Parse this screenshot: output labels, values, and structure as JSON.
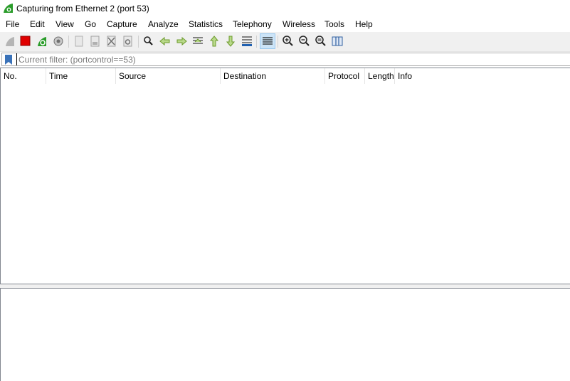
{
  "window": {
    "title": "Capturing from Ethernet 2 (port 53)",
    "icon": "wireshark-fin-icon"
  },
  "menu": [
    "File",
    "Edit",
    "View",
    "Go",
    "Capture",
    "Analyze",
    "Statistics",
    "Telephony",
    "Wireless",
    "Tools",
    "Help"
  ],
  "toolbar": {
    "icons": [
      "start-capture-icon",
      "stop-capture-icon",
      "restart-capture-icon",
      "capture-options-icon",
      "open-file-icon",
      "save-file-icon",
      "close-file-icon",
      "reload-file-icon",
      "find-packet-icon",
      "go-back-icon",
      "go-forward-icon",
      "go-to-packet-icon",
      "go-first-icon",
      "go-last-icon",
      "autoscroll-icon",
      "colorize-icon",
      "zoom-in-icon",
      "zoom-out-icon",
      "normal-size-icon",
      "resize-columns-icon"
    ],
    "accent": "#2a9c2a",
    "stop_color": "#e00000"
  },
  "filter": {
    "value": "",
    "placeholder": "Current filter: (portcontrol==53)"
  },
  "packet_list": {
    "columns": [
      "No.",
      "Time",
      "Source",
      "Destination",
      "Protocol",
      "Length",
      "Info"
    ],
    "rows": []
  }
}
